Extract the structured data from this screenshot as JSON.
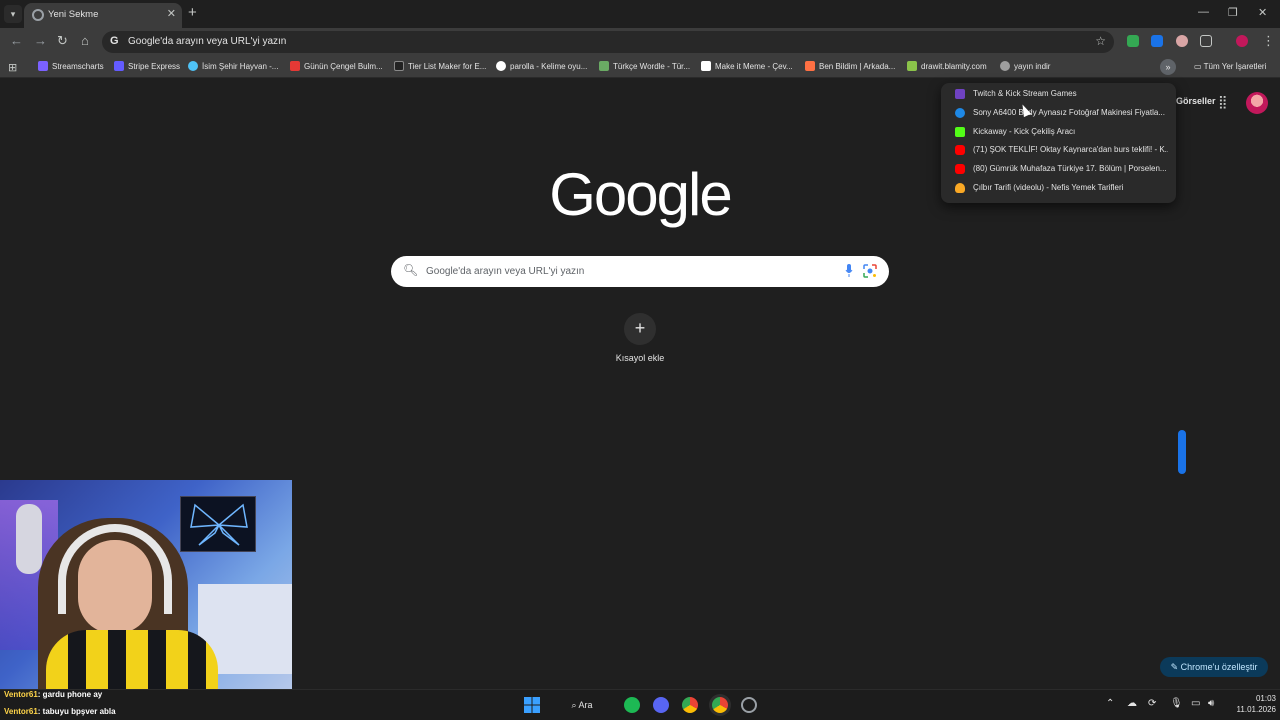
{
  "browser": {
    "tab": {
      "title": "Yeni Sekme",
      "close": "✕"
    },
    "new_tab": "+",
    "window_controls": {
      "minimize": "—",
      "restore": "❐",
      "close": "✕"
    },
    "omnibox": {
      "text": "Google'da arayın veya URL'yi yazın",
      "icon": "G"
    },
    "bookmarks": [
      {
        "label": "Streamscharts",
        "icon_color": "#7b61ff"
      },
      {
        "label": "Stripe Express",
        "icon_color": "#635bff"
      },
      {
        "label": "İsim Şehir Hayvan -...",
        "icon_color": "#4fc3f7"
      },
      {
        "label": "Günün Çengel Bulm...",
        "icon_color": "#e53935"
      },
      {
        "label": "Tier List Maker for E...",
        "icon_color": "#222222"
      },
      {
        "label": "parolla - Kelime oyu...",
        "icon_color": "#ffffff"
      },
      {
        "label": "Türkçe Wordle - Tür...",
        "icon_color": "#6aaa64"
      },
      {
        "label": "Make it Meme - Çev...",
        "icon_color": "#ffffff"
      },
      {
        "label": "Ben Bildim | Arkada...",
        "icon_color": "#ff7043"
      },
      {
        "label": "drawit.blamity.com",
        "icon_color": "#8bc34a"
      },
      {
        "label": "yayın indir",
        "icon_color": "#9e9e9e"
      }
    ],
    "overflow": "»",
    "all_bookmarks": "Tüm Yer İşaretleri"
  },
  "dropdown": [
    {
      "label": "Twitch & Kick Stream Games",
      "icon_color": "#6f42c1"
    },
    {
      "label": "Sony A6400 Body Aynasız Fotoğraf Makinesi Fiyatla...",
      "icon_color": "#1e88e5"
    },
    {
      "label": "Kickaway - Kick Çekiliş Aracı",
      "icon_color": "#53fc18"
    },
    {
      "label": "(71) ŞOK TEKLİF! Oktay Kaynarca'dan burs teklifi! - K...",
      "icon_color": "#ff0000"
    },
    {
      "label": "(80) Gümrük Muhafaza Türkiye 17. Bölüm | Porselen...",
      "icon_color": "#ff0000"
    },
    {
      "label": "Çılbır Tarifi (videolu) - Nefis Yemek Tarifleri",
      "icon_color": "#f9a825"
    }
  ],
  "page": {
    "top_link": "Görseller",
    "logo": "Google",
    "search_placeholder": "Google'da arayın veya URL'yi yazın",
    "add_shortcut_label": "Kısayol ekle",
    "customize_label": "Chrome'u özelleştir"
  },
  "chat": [
    {
      "user": "Ventor61",
      "text": ": gardu phone ay"
    },
    {
      "user": "Ventor61",
      "text": ": tabuyu bpşver abla"
    }
  ],
  "taskbar": {
    "search_label": "Ara",
    "time": "01:03",
    "date": "11.01.2026"
  },
  "colors": {
    "accent": "#1a73e8",
    "background": "#1f1f1f",
    "toolbar": "#3c3c3c"
  }
}
